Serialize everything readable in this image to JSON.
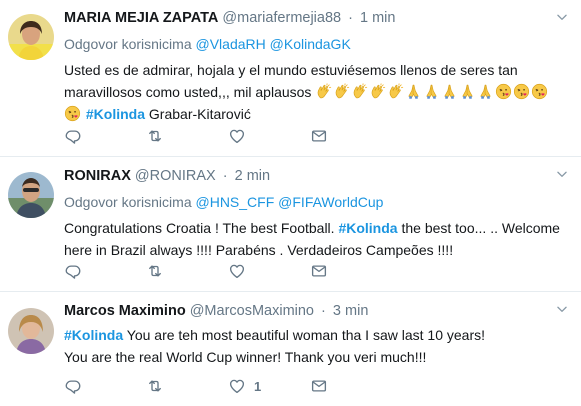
{
  "tweets": [
    {
      "name": "MARIA MEJIA ZAPATA",
      "handle": "@mariafermejia88",
      "time": "1 min",
      "reply_prefix": "Odgovor korisnicima",
      "reply_mentions": [
        "@VladaRH",
        "@KolindaGK"
      ],
      "text_a": "Usted es de admirar, hojala y el mundo estuviésemos llenos de seres tan maravillosos como usted,,, mil aplausos ",
      "hashtag": "#Kolinda",
      "text_b": " Grabar-Kitarović",
      "like_count": ""
    },
    {
      "name": "RONIRAX",
      "handle": "@RONIRAX",
      "time": "2 min",
      "reply_prefix": "Odgovor korisnicima",
      "reply_mentions": [
        "@HNS_CFF",
        "@FIFAWorldCup"
      ],
      "text_a": "Congratulations Croatia ! The best Football. ",
      "hashtag": "#Kolinda",
      "text_b": " the best too... .. Welcome here in Brazil always !!!! Parabéns . Verdadeiros Campeões !!!!",
      "like_count": ""
    },
    {
      "name": "Marcos Maximino",
      "handle": "@MarcosMaximino",
      "time": "3 min",
      "hashtag": "#Kolinda",
      "text_b": " You are teh most beautiful woman tha I saw last 10 years!",
      "text_c": "You are the real World Cup winner! Thank you veri much!!!",
      "like_count": "1"
    }
  ],
  "separator": "·",
  "emojis": [
    "clapping-hands",
    "clapping-hands",
    "clapping-hands",
    "clapping-hands",
    "clapping-hands",
    "folded-hands",
    "folded-hands",
    "folded-hands",
    "folded-hands",
    "folded-hands",
    "kissing-face",
    "kissing-face",
    "kissing-face",
    "kissing-face"
  ],
  "colors": {
    "link": "#1b95e0",
    "muted": "#657786",
    "text": "#14171a",
    "divider": "#e6ecf0"
  },
  "icons": [
    "reply-icon",
    "retweet-icon",
    "like-icon",
    "direct-message-icon",
    "chevron-down-icon"
  ]
}
